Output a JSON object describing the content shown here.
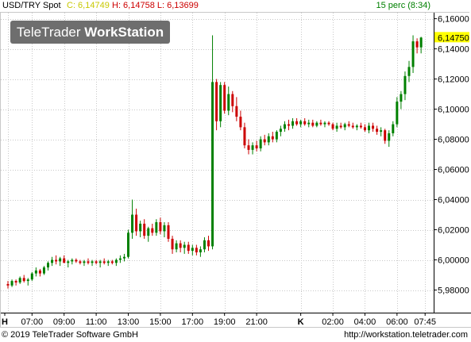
{
  "header": {
    "symbol": "USD/TRY Spot",
    "close": "C: 6,14749",
    "high_low": "H: 6,14758 L: 6,13699",
    "interval": "15 perc (8:34)"
  },
  "logo": {
    "part1": "TeleTrader",
    "part2": "WorkStation"
  },
  "footer": {
    "copyright": "© 2019 TeleTrader Software GmbH",
    "url": "http://workstation.teletrader.com"
  },
  "colors": {
    "up": "#008000",
    "down": "#cc0000",
    "last_price_box": "#ffff00",
    "grid": "#c8c8c8",
    "header_close": "#c8c800"
  },
  "chart_data": {
    "type": "candlestick",
    "ylim": [
      5.965,
      6.164
    ],
    "y_ticks": [
      "6,16000",
      "6,14000",
      "6,12000",
      "6,10000",
      "6,08000",
      "6,06000",
      "6,04000",
      "6,02000",
      "6,00000",
      "5,98000"
    ],
    "y_tick_values": [
      6.16,
      6.14,
      6.12,
      6.1,
      6.08,
      6.06,
      6.04,
      6.02,
      6.0,
      5.98
    ],
    "x_ticks": [
      "H",
      "07:00",
      "09:00",
      "11:00",
      "13:00",
      "15:00",
      "17:00",
      "19:00",
      "21:00",
      "K",
      "02:00",
      "04:00",
      "06:00",
      "07:45"
    ],
    "x_tick_index": [
      0,
      6,
      14,
      22,
      30,
      38,
      46,
      54,
      62,
      73,
      81,
      89,
      97,
      104
    ],
    "bold_ticks": [
      "H",
      "K"
    ],
    "last_price": "6,14750",
    "last_price_value": 6.1475,
    "grid": true,
    "candles": [
      [
        5.984,
        5.986,
        5.981,
        5.983
      ],
      [
        5.983,
        5.987,
        5.982,
        5.986
      ],
      [
        5.986,
        5.987,
        5.983,
        5.985
      ],
      [
        5.985,
        5.989,
        5.984,
        5.988
      ],
      [
        5.988,
        5.99,
        5.985,
        5.986
      ],
      [
        5.986,
        5.988,
        5.983,
        5.987
      ],
      [
        5.987,
        5.992,
        5.986,
        5.991
      ],
      [
        5.991,
        5.995,
        5.989,
        5.993
      ],
      [
        5.993,
        5.994,
        5.989,
        5.991
      ],
      [
        5.991,
        5.996,
        5.99,
        5.995
      ],
      [
        5.995,
        5.999,
        5.993,
        5.998
      ],
      [
        5.998,
        6.002,
        5.996,
        6.0
      ],
      [
        6.0,
        6.003,
        5.997,
        5.999
      ],
      [
        5.999,
        6.002,
        5.996,
        6.001
      ],
      [
        6.001,
        6.003,
        5.998,
        5.998
      ],
      [
        5.998,
        6.0,
        5.995,
        5.999
      ],
      [
        5.999,
        6.001,
        5.997,
        6.0
      ],
      [
        6.0,
        6.001,
        5.998,
        5.999
      ],
      [
        5.999,
        6.0,
        5.997,
        5.998
      ],
      [
        5.998,
        6.0,
        5.996,
        5.999
      ],
      [
        5.999,
        6.001,
        5.997,
        5.998
      ],
      [
        5.998,
        6.0,
        5.996,
        5.999
      ],
      [
        5.999,
        6.0,
        5.997,
        5.998
      ],
      [
        5.998,
        6.0,
        5.995,
        5.999
      ],
      [
        5.999,
        6.001,
        5.997,
        5.998
      ],
      [
        5.998,
        6.0,
        5.996,
        5.999
      ],
      [
        5.999,
        6.0,
        5.997,
        5.998
      ],
      [
        5.998,
        6.001,
        5.996,
        6.0
      ],
      [
        6.0,
        6.003,
        5.998,
        6.001
      ],
      [
        6.001,
        6.004,
        5.999,
        6.002
      ],
      [
        6.002,
        6.02,
        6.001,
        6.018
      ],
      [
        6.018,
        6.04,
        6.014,
        6.03
      ],
      [
        6.03,
        6.034,
        6.016,
        6.019
      ],
      [
        6.019,
        6.026,
        6.015,
        6.024
      ],
      [
        6.024,
        6.027,
        6.014,
        6.016
      ],
      [
        6.016,
        6.022,
        6.012,
        6.021
      ],
      [
        6.021,
        6.024,
        6.016,
        6.018
      ],
      [
        6.018,
        6.027,
        6.016,
        6.025
      ],
      [
        6.025,
        6.028,
        6.017,
        6.019
      ],
      [
        6.019,
        6.025,
        6.015,
        6.023
      ],
      [
        6.023,
        6.025,
        6.012,
        6.014
      ],
      [
        6.014,
        6.016,
        6.004,
        6.007
      ],
      [
        6.007,
        6.013,
        6.005,
        6.011
      ],
      [
        6.011,
        6.013,
        6.005,
        6.008
      ],
      [
        6.008,
        6.012,
        6.004,
        6.01
      ],
      [
        6.01,
        6.012,
        6.004,
        6.006
      ],
      [
        6.006,
        6.01,
        6.003,
        6.008
      ],
      [
        6.008,
        6.01,
        6.003,
        6.005
      ],
      [
        6.005,
        6.009,
        6.002,
        6.007
      ],
      [
        6.007,
        6.015,
        6.005,
        6.013
      ],
      [
        6.013,
        6.016,
        6.006,
        6.009
      ],
      [
        6.009,
        6.149,
        6.007,
        6.118
      ],
      [
        6.118,
        6.12,
        6.086,
        6.092
      ],
      [
        6.092,
        6.118,
        6.088,
        6.116
      ],
      [
        6.116,
        6.118,
        6.097,
        6.099
      ],
      [
        6.099,
        6.115,
        6.096,
        6.11
      ],
      [
        6.11,
        6.112,
        6.098,
        6.102
      ],
      [
        6.102,
        6.108,
        6.092,
        6.095
      ],
      [
        6.095,
        6.099,
        6.086,
        6.088
      ],
      [
        6.088,
        6.091,
        6.074,
        6.076
      ],
      [
        6.076,
        6.08,
        6.07,
        6.073
      ],
      [
        6.073,
        6.078,
        6.07,
        6.076
      ],
      [
        6.076,
        6.079,
        6.072,
        6.074
      ],
      [
        6.074,
        6.082,
        6.072,
        6.08
      ],
      [
        6.08,
        6.083,
        6.076,
        6.078
      ],
      [
        6.078,
        6.084,
        6.076,
        6.082
      ],
      [
        6.082,
        6.085,
        6.078,
        6.08
      ],
      [
        6.08,
        6.086,
        6.078,
        6.085
      ],
      [
        6.085,
        6.089,
        6.082,
        6.087
      ],
      [
        6.087,
        6.092,
        6.085,
        6.09
      ],
      [
        6.09,
        6.093,
        6.086,
        6.089
      ],
      [
        6.089,
        6.094,
        6.087,
        6.092
      ],
      [
        6.092,
        6.094,
        6.089,
        6.09
      ],
      [
        6.09,
        6.093,
        6.088,
        6.092
      ],
      [
        6.092,
        6.094,
        6.089,
        6.09
      ],
      [
        6.09,
        6.093,
        6.088,
        6.091
      ],
      [
        6.091,
        6.093,
        6.088,
        6.089
      ],
      [
        6.089,
        6.092,
        6.088,
        6.091
      ],
      [
        6.091,
        6.093,
        6.089,
        6.09
      ],
      [
        6.09,
        6.092,
        6.088,
        6.091
      ],
      [
        6.091,
        6.092,
        6.089,
        6.09
      ],
      [
        6.09,
        6.091,
        6.086,
        6.087
      ],
      [
        6.087,
        6.091,
        6.085,
        6.089
      ],
      [
        6.089,
        6.091,
        6.087,
        6.088
      ],
      [
        6.088,
        6.091,
        6.086,
        6.09
      ],
      [
        6.09,
        6.092,
        6.088,
        6.089
      ],
      [
        6.089,
        6.091,
        6.087,
        6.088
      ],
      [
        6.088,
        6.09,
        6.086,
        6.089
      ],
      [
        6.089,
        6.091,
        6.087,
        6.088
      ],
      [
        6.088,
        6.09,
        6.085,
        6.086
      ],
      [
        6.086,
        6.091,
        6.084,
        6.089
      ],
      [
        6.089,
        6.091,
        6.085,
        6.087
      ],
      [
        6.087,
        6.089,
        6.083,
        6.085
      ],
      [
        6.085,
        6.088,
        6.082,
        6.086
      ],
      [
        6.086,
        6.087,
        6.077,
        6.079
      ],
      [
        6.079,
        6.086,
        6.075,
        6.084
      ],
      [
        6.084,
        6.092,
        6.082,
        6.09
      ],
      [
        6.09,
        6.108,
        6.088,
        6.105
      ],
      [
        6.105,
        6.112,
        6.1,
        6.11
      ],
      [
        6.11,
        6.125,
        6.106,
        6.122
      ],
      [
        6.122,
        6.132,
        6.118,
        6.128
      ],
      [
        6.128,
        6.149,
        6.124,
        6.145
      ],
      [
        6.145,
        6.147,
        6.137,
        6.141
      ],
      [
        6.141,
        6.148,
        6.137,
        6.1475
      ]
    ]
  }
}
